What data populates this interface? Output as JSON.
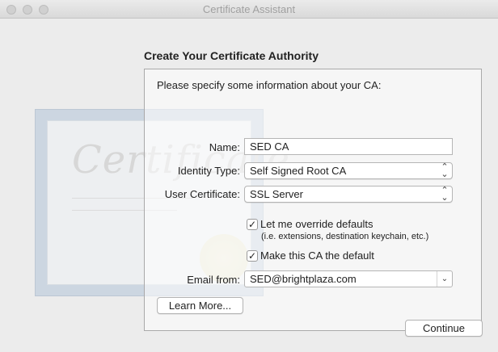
{
  "window": {
    "title": "Certificate Assistant"
  },
  "page": {
    "heading": "Create Your Certificate Authority",
    "intro": "Please specify some information about your CA:"
  },
  "form": {
    "name_label": "Name:",
    "name_value": "SED CA",
    "identity_type_label": "Identity Type:",
    "identity_type_value": "Self Signed Root CA",
    "user_certificate_label": "User Certificate:",
    "user_certificate_value": "SSL Server",
    "override_label": "Let me override defaults",
    "override_hint": "(i.e. extensions, destination keychain, etc.)",
    "override_checked": true,
    "default_label": "Make this CA the default",
    "default_checked": true,
    "email_label": "Email from:",
    "email_value": "SED@brightplaza.com"
  },
  "buttons": {
    "learn_more": "Learn More...",
    "continue": "Continue"
  },
  "icons": {
    "close": "close-icon",
    "minimize": "minimize-icon",
    "zoom": "zoom-icon",
    "popup_chevrons": "up-down-chevron-icon",
    "combo_arrow": "chevron-down-icon",
    "checkmark": "checkmark-icon"
  }
}
